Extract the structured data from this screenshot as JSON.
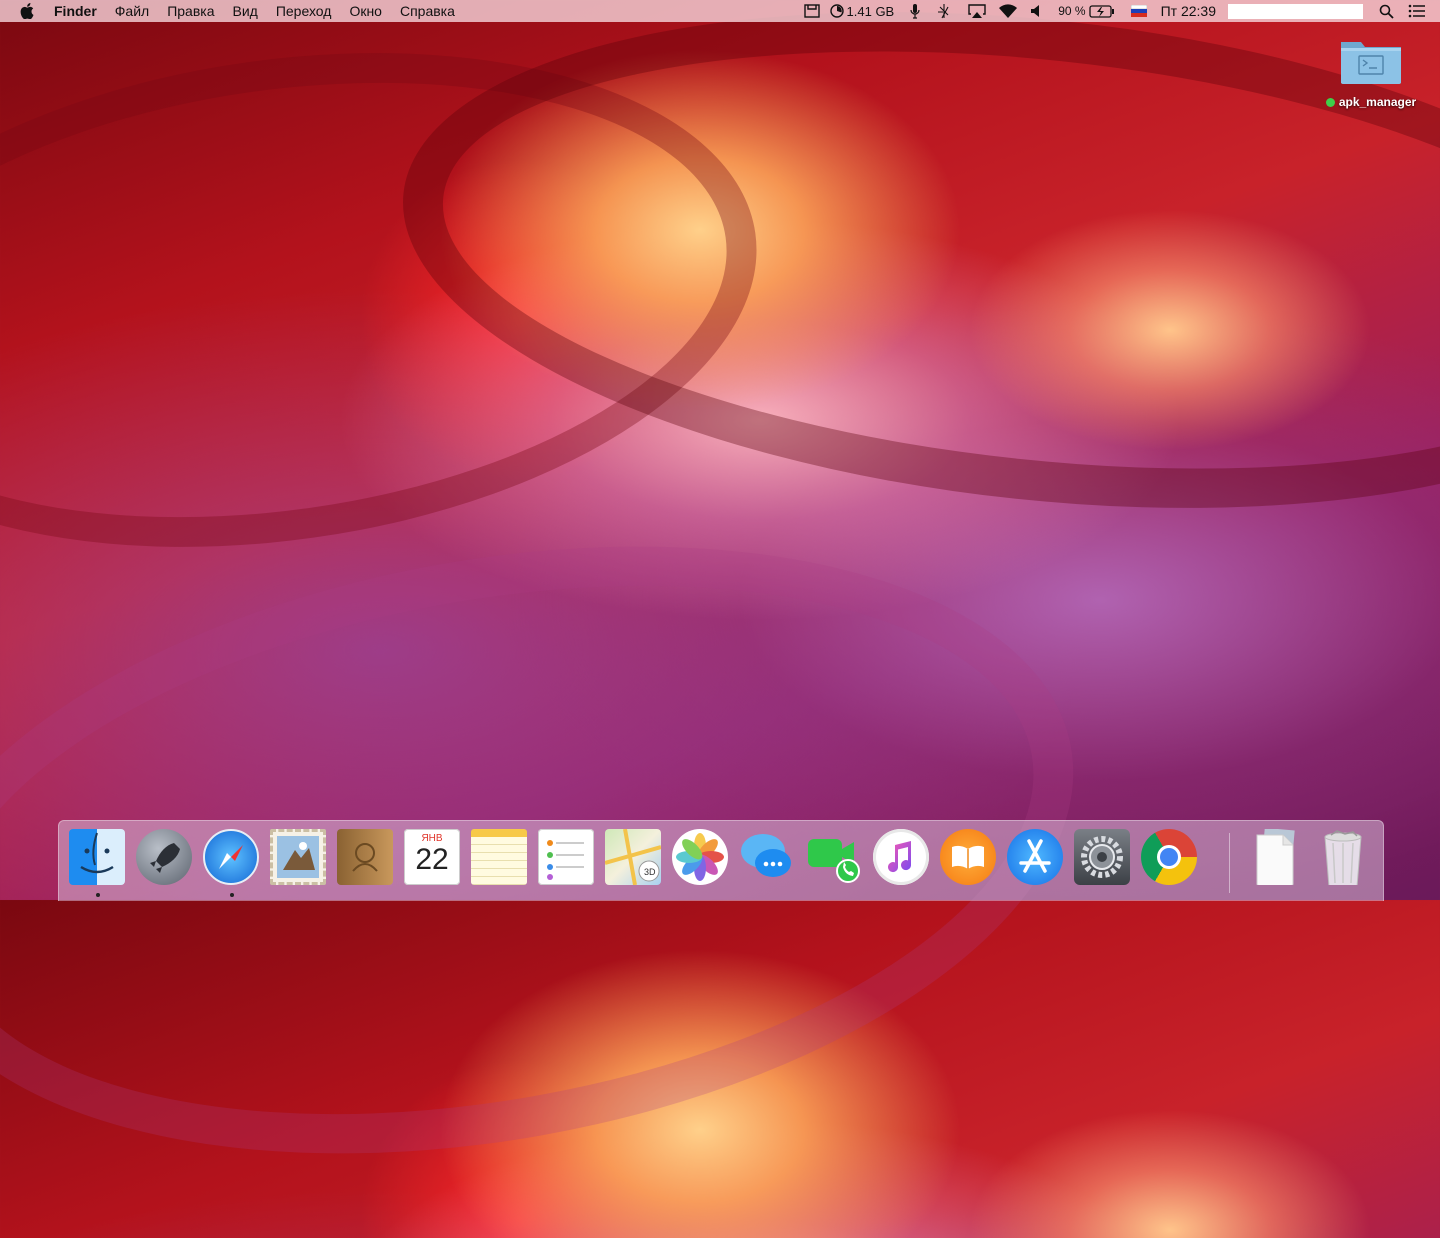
{
  "menubar": {
    "app_name": "Finder",
    "items": [
      {
        "label": "Файл"
      },
      {
        "label": "Правка"
      },
      {
        "label": "Вид"
      },
      {
        "label": "Переход"
      },
      {
        "label": "Окно"
      },
      {
        "label": "Справка"
      }
    ],
    "status": {
      "memory": "1.41 GB",
      "battery": "90 %",
      "clock": "Пт 22:39"
    }
  },
  "desktop": {
    "folder_label": "apk_manager",
    "tag_color": "#3ecf4a"
  },
  "dock": {
    "calendar_month": "ЯНВ",
    "calendar_day": "22",
    "apps": [
      {
        "name": "Finder",
        "icon": "finder-icon",
        "running": true
      },
      {
        "name": "Launchpad",
        "icon": "rocket-icon",
        "running": false
      },
      {
        "name": "Safari",
        "icon": "compass-icon",
        "running": true
      },
      {
        "name": "Mail",
        "icon": "stamp-icon",
        "running": false
      },
      {
        "name": "Contacts",
        "icon": "address-book-icon",
        "running": false
      },
      {
        "name": "Calendar",
        "icon": "calendar-icon",
        "running": false
      },
      {
        "name": "Notes",
        "icon": "notepad-icon",
        "running": false
      },
      {
        "name": "Reminders",
        "icon": "checklist-icon",
        "running": false
      },
      {
        "name": "Maps",
        "icon": "map-icon",
        "running": false
      },
      {
        "name": "Photos",
        "icon": "flower-icon",
        "running": false
      },
      {
        "name": "Messages",
        "icon": "speech-bubble-icon",
        "running": false
      },
      {
        "name": "FaceTime",
        "icon": "video-camera-icon",
        "running": false
      },
      {
        "name": "iTunes",
        "icon": "music-note-icon",
        "running": false
      },
      {
        "name": "iBooks",
        "icon": "book-icon",
        "running": false
      },
      {
        "name": "App Store",
        "icon": "app-store-icon",
        "running": false
      },
      {
        "name": "System Preferences",
        "icon": "gear-icon",
        "running": false
      },
      {
        "name": "Google Chrome",
        "icon": "chrome-icon",
        "running": false
      },
      {
        "name": "Documents",
        "icon": "document-icon",
        "running": false
      },
      {
        "name": "Trash",
        "icon": "trash-icon",
        "running": false
      }
    ]
  }
}
